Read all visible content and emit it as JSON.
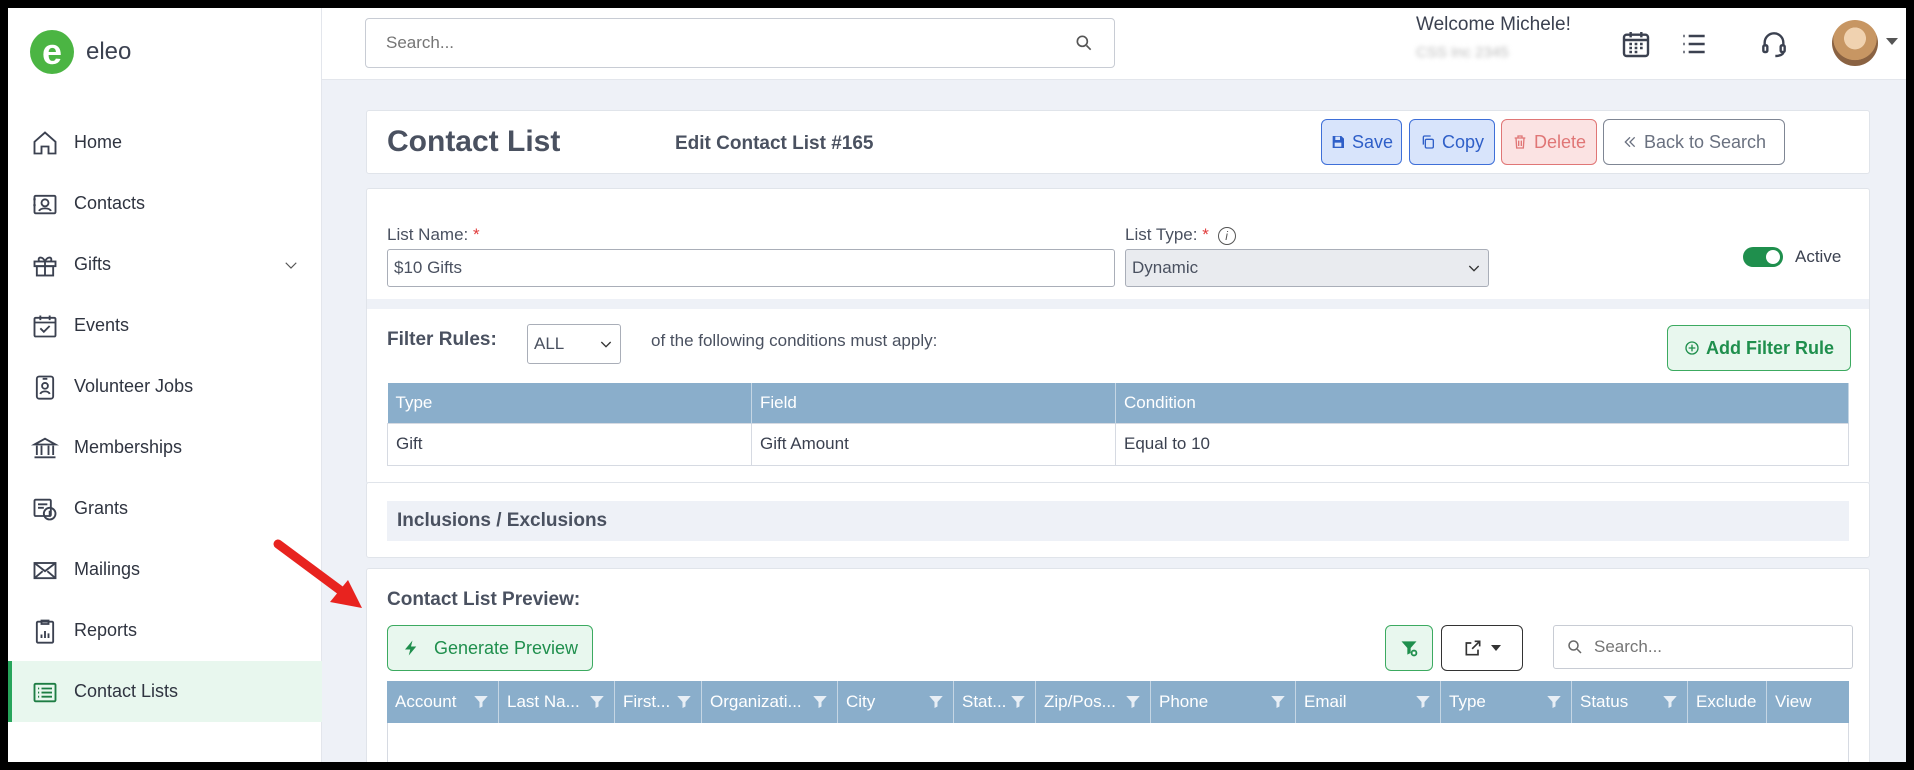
{
  "app": {
    "logo_letter": "e",
    "logo_text": "eleo",
    "brand_color": "#4bb543"
  },
  "sidebar": {
    "items": [
      {
        "label": "Home",
        "icon": "home-icon"
      },
      {
        "label": "Contacts",
        "icon": "contact-card-icon"
      },
      {
        "label": "Gifts",
        "icon": "gift-icon"
      },
      {
        "label": "Events",
        "icon": "calendar-check-icon"
      },
      {
        "label": "Volunteer Jobs",
        "icon": "id-badge-icon"
      },
      {
        "label": "Memberships",
        "icon": "bank-icon"
      },
      {
        "label": "Grants",
        "icon": "grant-icon"
      },
      {
        "label": "Mailings",
        "icon": "envelope-icon"
      },
      {
        "label": "Reports",
        "icon": "report-icon"
      },
      {
        "label": "Contact Lists",
        "icon": "list-icon"
      }
    ],
    "active": "Contact Lists"
  },
  "topbar": {
    "search_placeholder": "Search...",
    "welcome": "Welcome Michele!",
    "welcome_sub": "CSS Inc 2345"
  },
  "header": {
    "title": "Contact List",
    "subtitle": "Edit Contact List #165",
    "save_label": "Save",
    "copy_label": "Copy",
    "delete_label": "Delete",
    "back_label": "Back to Search"
  },
  "form": {
    "list_name_label": "List Name:",
    "required_mark": "*",
    "list_name_value": "$10 Gifts",
    "list_type_label": "List Type:",
    "list_type_value": "Dynamic",
    "info_glyph": "i",
    "active_label": "Active",
    "active_on": true
  },
  "filter": {
    "label": "Filter Rules:",
    "match_value": "ALL",
    "match_text": "of the following conditions must apply:",
    "add_rule_label": "Add Filter Rule",
    "columns": [
      "Type",
      "Field",
      "Condition"
    ],
    "rows": [
      [
        "Gift",
        "Gift Amount",
        "Equal to 10"
      ]
    ]
  },
  "inclusions": {
    "label": "Inclusions / Exclusions"
  },
  "preview": {
    "title": "Contact List Preview:",
    "generate_label": "Generate Preview",
    "search_placeholder": "Search...",
    "columns": [
      "Account",
      "Last Na...",
      "First...",
      "Organizati...",
      "City",
      "Stat...",
      "Zip/Pos...",
      "Phone",
      "Email",
      "Type",
      "Status",
      "Exclude",
      "View"
    ]
  }
}
